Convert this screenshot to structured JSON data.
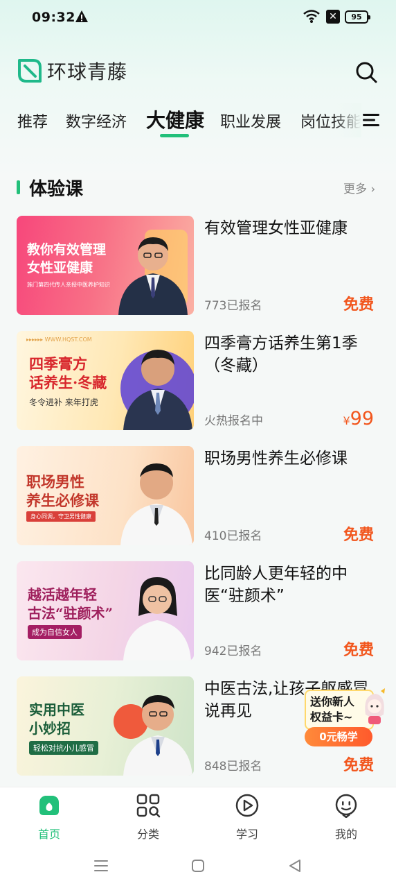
{
  "status_bar": {
    "time": "09:32",
    "battery": "95"
  },
  "header": {
    "brand_name": "环球青藤",
    "logo_icon": "leaf-logo-icon",
    "search_icon": "search-icon"
  },
  "tabs": {
    "items": [
      {
        "label": "推荐"
      },
      {
        "label": "数字经济"
      },
      {
        "label": "大健康"
      },
      {
        "label": "职业发展"
      },
      {
        "label": "岗位技能"
      }
    ],
    "active_index": 2,
    "menu_icon": "menu-icon"
  },
  "section": {
    "title": "体验课",
    "more": "更多 ›"
  },
  "courses": [
    {
      "title": "有效管理女性亚健康",
      "meta": "773已报名",
      "price": "免费",
      "thumb": {
        "line1": "教你有效管理",
        "line2": "女性亚健康",
        "sub": "施门第四代传人亲授中医养护知识"
      }
    },
    {
      "title": "四季膏方话养生第1季（冬藏）",
      "meta": "火热报名中",
      "price_symbol": "¥",
      "price": "99",
      "thumb": {
        "line1": "四季膏方",
        "line2": "话养生·冬藏",
        "sub": "冬令进补 来年打虎",
        "tag": "▸▸▸▸▸▸ WWW.HQST.COM"
      }
    },
    {
      "title": "职场男性养生必修课",
      "meta": "410已报名",
      "price": "免费",
      "thumb": {
        "line1": "职场男性",
        "line2": "养生必修课",
        "sub": "身心同调，守卫男性健康"
      }
    },
    {
      "title": "比同龄人更年轻的中医“驻颜术”",
      "meta": "942已报名",
      "price": "免费",
      "thumb": {
        "line1": "越活越年轻",
        "line2": "古法“驻颜术”",
        "sub": "成为自信女人"
      }
    },
    {
      "title": "中医古法,让孩子躯感冒说再见",
      "meta": "848已报名",
      "price": "免费",
      "thumb": {
        "line1": "实用中医",
        "line2": "小妙招",
        "sub": "轻松对抗小儿感冒"
      }
    }
  ],
  "promo": {
    "line1": "送你新人",
    "line2": "权益卡~",
    "button": "0元畅学"
  },
  "tabbar": [
    {
      "label": "首页",
      "icon": "home-icon",
      "active": true
    },
    {
      "label": "分类",
      "icon": "category-icon",
      "active": false
    },
    {
      "label": "学习",
      "icon": "play-icon",
      "active": false
    },
    {
      "label": "我的",
      "icon": "profile-icon",
      "active": false
    }
  ],
  "colors": {
    "accent": "#22c07a",
    "price": "#f2561d"
  }
}
